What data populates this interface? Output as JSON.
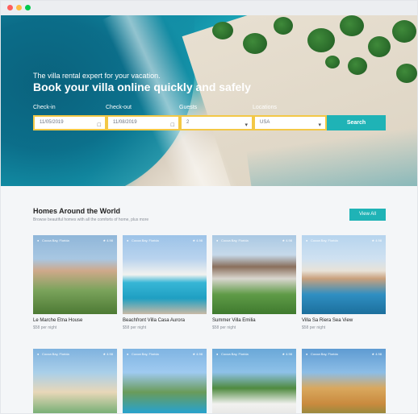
{
  "hero": {
    "subtitle": "The villa rental expert for your vacation.",
    "title": "Book your villa online quickly and safely"
  },
  "search": {
    "checkin_label": "Check-in",
    "checkout_label": "Check-out",
    "guests_label": "Guests",
    "location_label": "Locations",
    "checkin_value": "11/05/2019",
    "checkout_value": "11/08/2019",
    "guests_value": "2",
    "location_value": "USA",
    "button_label": "Search"
  },
  "section": {
    "title": "Homes Around the World",
    "subtitle": "Browse beautiful homes with all the comforts of home, plus more",
    "view_all_label": "View All"
  },
  "cards": [
    {
      "location": "Cocoa Bay, Florida",
      "rating": "4.98",
      "name": "Le Marche Etna House",
      "price": "$58 per night"
    },
    {
      "location": "Cocoa Bay, Florida",
      "rating": "4.98",
      "name": "Beachfront Villa Casa Aurora",
      "price": "$58 per night"
    },
    {
      "location": "Cocoa Bay, Florida",
      "rating": "4.98",
      "name": "Summer Villa Emilia",
      "price": "$58 per night"
    },
    {
      "location": "Cocoa Bay, Florida",
      "rating": "4.98",
      "name": "Villa Sa Riera Sea View",
      "price": "$58 per night"
    },
    {
      "location": "Cocoa Bay, Florida",
      "rating": "4.98"
    },
    {
      "location": "Cocoa Bay, Florida",
      "rating": "4.98"
    },
    {
      "location": "Cocoa Bay, Florida",
      "rating": "4.98"
    },
    {
      "location": "Cocoa Bay, Florida",
      "rating": "4.98"
    }
  ],
  "icons": {
    "calendar": "calendar-icon",
    "dropdown": "chevron-down-icon",
    "star": "star-icon",
    "pin": "location-pin-icon"
  },
  "colors": {
    "accent": "#1fb3b6",
    "field_border": "#f3c846"
  }
}
